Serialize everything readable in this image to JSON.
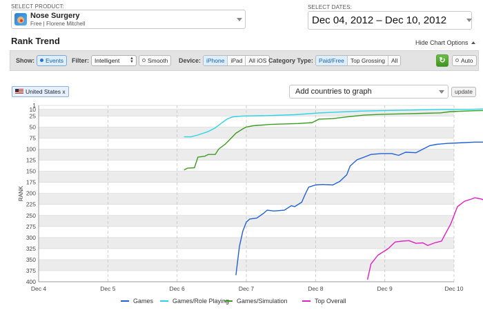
{
  "product": {
    "section_label": "SELECT PRODUCT:",
    "name": "Nose Surgery",
    "subtitle": "Free | Florene Mitchell"
  },
  "dates": {
    "section_label": "SELECT DATES:",
    "range": "Dec 04, 2012 – Dec 10, 2012"
  },
  "page_title": "Rank Trend",
  "hide_chart_options": "Hide Chart Options",
  "toolbar": {
    "show_label": "Show:",
    "events_label": "Events",
    "filter_label": "Filter:",
    "filter_value": "Intelligent",
    "smooth_label": "Smooth",
    "device_label": "Device:",
    "devices": [
      {
        "label": "iPhone",
        "active": true
      },
      {
        "label": "iPad",
        "active": false
      },
      {
        "label": "All iOS",
        "active": false
      }
    ],
    "category_type_label": "Category Type:",
    "category_types": [
      {
        "label": "Paid/Free",
        "active": true
      },
      {
        "label": "Top Grossing",
        "active": false
      },
      {
        "label": "All",
        "active": false
      }
    ],
    "auto_label": "Auto"
  },
  "countries": {
    "selected": "United States x",
    "add_placeholder": "Add countries to graph",
    "update_label": "update"
  },
  "chart_data": {
    "type": "line",
    "title": "",
    "xlabel": "",
    "ylabel": "RANK",
    "y_inverted": true,
    "ylim": [
      1,
      400
    ],
    "y_ticks": [
      1,
      10,
      25,
      50,
      75,
      100,
      125,
      150,
      175,
      200,
      225,
      250,
      275,
      300,
      325,
      350,
      375,
      400
    ],
    "x_range": [
      4.0,
      10.0
    ],
    "x_ticks": [
      {
        "x": 4,
        "label": "Dec 4"
      },
      {
        "x": 5,
        "label": "Dec 5"
      },
      {
        "x": 6,
        "label": "Dec 6"
      },
      {
        "x": 7,
        "label": "Dec 7"
      },
      {
        "x": 8,
        "label": "Dec 8"
      },
      {
        "x": 9,
        "label": "Dec 9"
      },
      {
        "x": 10,
        "label": "Dec 10"
      }
    ],
    "grid": true,
    "legend_position": "bottom",
    "series": [
      {
        "name": "Games",
        "color": "#1f5fd6",
        "points": [
          [
            6.85,
            385
          ],
          [
            6.9,
            320
          ],
          [
            6.95,
            285
          ],
          [
            7.0,
            265
          ],
          [
            7.05,
            258
          ],
          [
            7.15,
            256
          ],
          [
            7.25,
            245
          ],
          [
            7.3,
            238
          ],
          [
            7.4,
            240
          ],
          [
            7.55,
            238
          ],
          [
            7.65,
            228
          ],
          [
            7.7,
            230
          ],
          [
            7.8,
            220
          ],
          [
            7.85,
            202
          ],
          [
            7.9,
            186
          ],
          [
            8.0,
            181
          ],
          [
            8.1,
            180
          ],
          [
            8.25,
            181
          ],
          [
            8.35,
            173
          ],
          [
            8.45,
            158
          ],
          [
            8.5,
            138
          ],
          [
            8.6,
            124
          ],
          [
            8.7,
            118
          ],
          [
            8.8,
            112
          ],
          [
            8.95,
            110
          ],
          [
            9.1,
            110
          ],
          [
            9.2,
            114
          ],
          [
            9.3,
            107
          ],
          [
            9.45,
            108
          ],
          [
            9.55,
            100
          ],
          [
            9.65,
            92
          ],
          [
            9.75,
            89
          ],
          [
            9.9,
            87
          ],
          [
            10.05,
            86
          ],
          [
            10.3,
            84
          ],
          [
            10.48,
            84
          ],
          [
            10.55,
            80
          ],
          [
            10.6,
            72
          ],
          [
            10.65,
            69
          ]
        ]
      },
      {
        "name": "Games/Role Playing",
        "color": "#29d4ea",
        "points": [
          [
            6.1,
            72
          ],
          [
            6.2,
            72
          ],
          [
            6.3,
            68
          ],
          [
            6.45,
            60
          ],
          [
            6.55,
            52
          ],
          [
            6.65,
            40
          ],
          [
            6.72,
            32
          ],
          [
            6.8,
            27
          ],
          [
            6.95,
            25
          ],
          [
            7.3,
            24
          ],
          [
            7.7,
            22
          ],
          [
            8.05,
            18
          ],
          [
            8.35,
            16
          ],
          [
            8.65,
            14
          ],
          [
            8.9,
            13
          ],
          [
            9.25,
            12
          ],
          [
            9.55,
            11
          ],
          [
            9.85,
            10
          ],
          [
            10.2,
            10
          ],
          [
            10.45,
            9
          ],
          [
            10.55,
            8
          ],
          [
            10.65,
            8
          ]
        ]
      },
      {
        "name": "Games/Simulation",
        "color": "#3a9c1e",
        "points": [
          [
            6.1,
            147
          ],
          [
            6.15,
            143
          ],
          [
            6.25,
            142
          ],
          [
            6.3,
            118
          ],
          [
            6.4,
            116
          ],
          [
            6.45,
            112
          ],
          [
            6.55,
            112
          ],
          [
            6.6,
            100
          ],
          [
            6.7,
            88
          ],
          [
            6.75,
            80
          ],
          [
            6.85,
            64
          ],
          [
            6.95,
            54
          ],
          [
            7.0,
            50
          ],
          [
            7.1,
            47
          ],
          [
            7.35,
            44
          ],
          [
            7.75,
            42
          ],
          [
            7.95,
            40
          ],
          [
            8.05,
            32
          ],
          [
            8.25,
            31
          ],
          [
            8.45,
            27
          ],
          [
            8.7,
            23
          ],
          [
            9.0,
            21
          ],
          [
            9.3,
            20
          ],
          [
            9.55,
            19
          ],
          [
            9.8,
            18
          ],
          [
            9.95,
            15
          ],
          [
            10.3,
            13
          ],
          [
            10.55,
            12
          ],
          [
            10.65,
            12
          ]
        ]
      },
      {
        "name": "Top Overall",
        "color": "#e21ec4",
        "points": [
          [
            8.75,
            395
          ],
          [
            8.8,
            360
          ],
          [
            8.9,
            340
          ],
          [
            9.05,
            325
          ],
          [
            9.15,
            310
          ],
          [
            9.25,
            308
          ],
          [
            9.35,
            307
          ],
          [
            9.45,
            313
          ],
          [
            9.55,
            312
          ],
          [
            9.62,
            318
          ],
          [
            9.72,
            312
          ],
          [
            9.82,
            308
          ],
          [
            9.88,
            290
          ],
          [
            9.95,
            270
          ],
          [
            10.05,
            230
          ],
          [
            10.15,
            218
          ],
          [
            10.25,
            213
          ],
          [
            10.3,
            210
          ],
          [
            10.4,
            213
          ],
          [
            10.5,
            222
          ],
          [
            10.58,
            222
          ],
          [
            10.62,
            214
          ],
          [
            10.68,
            205
          ],
          [
            10.75,
            186
          ],
          [
            10.8,
            184
          ]
        ]
      }
    ]
  }
}
